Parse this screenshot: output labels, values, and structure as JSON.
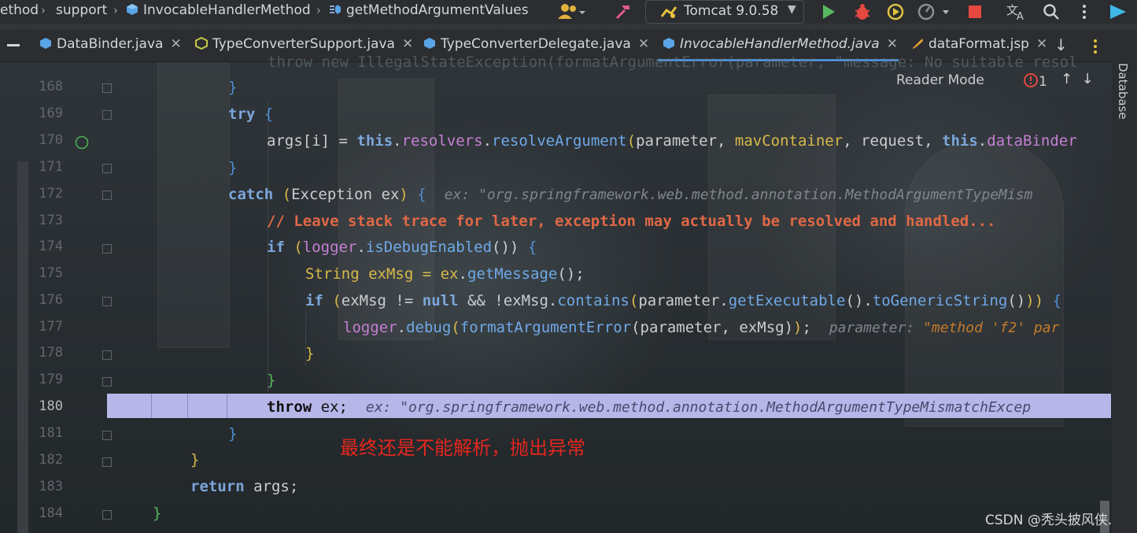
{
  "breadcrumb": {
    "items": [
      "ethod",
      "support",
      "InvocableHandlerMethod",
      "getMethodArgumentValues"
    ]
  },
  "toolbar": {
    "run_config": "Tomcat 9.0.58"
  },
  "tabs": [
    {
      "label": "DataBinder.java",
      "active": false
    },
    {
      "label": "TypeConverterSupport.java",
      "active": false
    },
    {
      "label": "TypeConverterDelegate.java",
      "active": false
    },
    {
      "label": "InvocableHandlerMethod.java",
      "active": true
    },
    {
      "label": "dataFormat.jsp",
      "active": false
    }
  ],
  "editor": {
    "reader_mode": "Reader Mode",
    "problems_count": "1",
    "faded_line": "throw new IllegalStateException(formatArgumentError(parameter, \"message: No suitable resol",
    "line_numbers": [
      "168",
      "169",
      "170",
      "171",
      "172",
      "173",
      "174",
      "175",
      "176",
      "177",
      "178",
      "179",
      "180",
      "181",
      "182",
      "183",
      "184"
    ],
    "code": {
      "l169_try": "try",
      "l170_args": "args[i] = ",
      "l170_this": "this",
      "l170_resolvers": "resolvers",
      "l170_method": "resolveArgument",
      "l170_params": "parameter, ",
      "l170_mav": "mavContainer",
      "l170_req": ", request, ",
      "l170_this2": "this",
      "l170_binder": "dataBinder",
      "l172_catch": "catch",
      "l172_type": "Exception ex",
      "l172_hint": "ex: \"org.springframework.web.method.annotation.MethodArgumentTypeMism",
      "l173_comment": "// Leave stack trace for later, exception may actually be resolved and handled...",
      "l174_if": "if",
      "l174_logger": "logger",
      "l174_method": "isDebugEnabled",
      "l175_decl": "String exMsg = ",
      "l175_ex": "ex",
      "l175_method": "getMessage",
      "l176_if": "if",
      "l176_cond": "exMsg != ",
      "l176_null": "null",
      "l176_and": " && !exMsg.",
      "l176_contains": "contains",
      "l176_param": "parameter.",
      "l176_getexe": "getExecutable",
      "l176_togen": "toGenericString",
      "l177_logger": "logger",
      "l177_debug": "debug",
      "l177_fmt": "formatArgumentError",
      "l177_args": "parameter, exMsg",
      "l177_hint_key": "parameter: ",
      "l177_hint_val": "\"method 'f2' par",
      "l180_throw": "throw",
      "l180_rest": " ex;",
      "l180_hint": "ex: \"org.springframework.web.method.annotation.MethodArgumentTypeMismatchExcep",
      "l183_return": "return",
      "l183_rest": " args;"
    },
    "annotation": "最终还是不能解析，抛出异常"
  },
  "sidebar": {
    "database": "Database"
  },
  "watermark": "CSDN @秃头披风侠.",
  "colors": {
    "highlight_line": "#b7b6e9",
    "annotation": "#e4271f",
    "keyword": "#7ba6d9",
    "comment": "#e06846"
  }
}
